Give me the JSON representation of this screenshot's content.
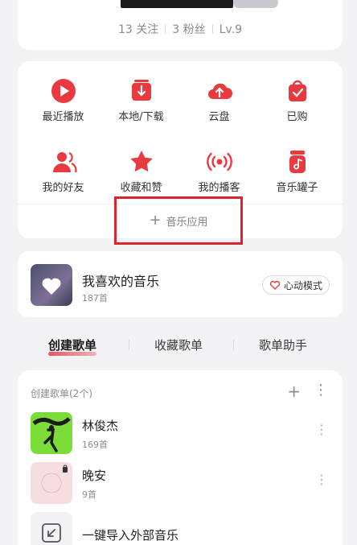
{
  "profile": {
    "following": "13 关注",
    "followers": "3 粉丝",
    "level": "Lv.9"
  },
  "quick_grid": [
    {
      "label": "最近播放",
      "icon": "recent-play-icon"
    },
    {
      "label": "本地/下载",
      "icon": "local-download-icon"
    },
    {
      "label": "云盘",
      "icon": "cloud-icon"
    },
    {
      "label": "已购",
      "icon": "purchased-bag-icon"
    },
    {
      "label": "我的好友",
      "icon": "friends-icon"
    },
    {
      "label": "收藏和赞",
      "icon": "star-icon"
    },
    {
      "label": "我的播客",
      "icon": "podcast-icon"
    },
    {
      "label": "音乐罐子",
      "icon": "music-jar-icon"
    }
  ],
  "add_app_label": "音乐应用",
  "liked": {
    "title": "我喜欢的音乐",
    "count": "187首",
    "mode_label": "心动模式"
  },
  "tabs": [
    "创建歌单",
    "收藏歌单",
    "歌单助手"
  ],
  "playlists": {
    "header": "创建歌单(2个)",
    "items": [
      {
        "name": "林俊杰",
        "count": "169首"
      },
      {
        "name": "晚安",
        "count": "9首"
      }
    ],
    "import_label": "一键导入外部音乐"
  },
  "colors": {
    "accent": "#e83a3f",
    "highlight_box": "#d8262f"
  }
}
